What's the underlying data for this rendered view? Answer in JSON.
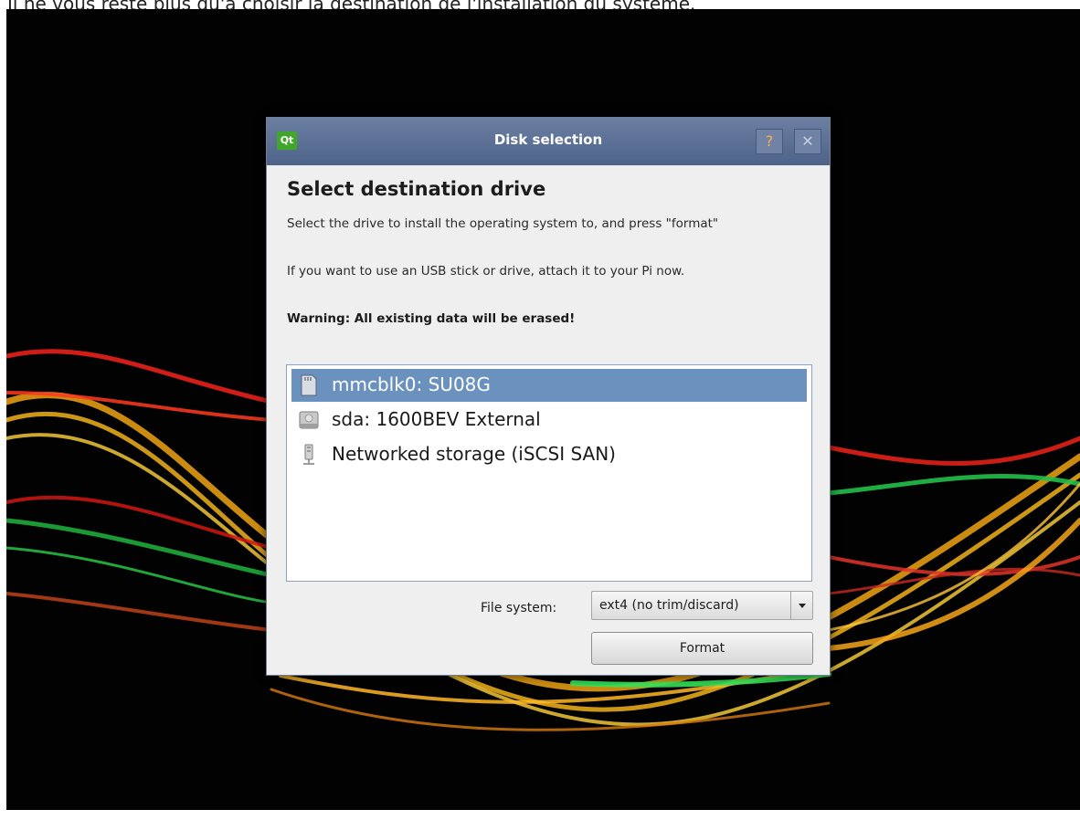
{
  "page_caption": "Il ne vous reste plus qu'à choisir la destination de l'installation du système.",
  "window": {
    "title": "Disk selection",
    "logo_text": "Qt",
    "help_glyph": "?",
    "close_glyph": "✕"
  },
  "content": {
    "heading": "Select destination drive",
    "instruction": "Select the drive to install the operating system to, and press \"format\"",
    "usb_hint": "If you want to use an USB stick or drive, attach it to your Pi now.",
    "warning": "Warning: All existing data will be erased!"
  },
  "drives": [
    {
      "label": "mmcblk0: SU08G",
      "icon": "sd-card-icon",
      "selected": true
    },
    {
      "label": "sda: 1600BEV External",
      "icon": "hard-drive-icon",
      "selected": false
    },
    {
      "label": "Networked storage (iSCSI SAN)",
      "icon": "network-storage-icon",
      "selected": false
    }
  ],
  "file_system": {
    "label": "File system:",
    "selected": "ext4 (no trim/discard)"
  },
  "format_button": "Format",
  "colors": {
    "selection": "#6b92bf",
    "titlebar": "#5b6f94",
    "qt_green": "#41a62a"
  }
}
